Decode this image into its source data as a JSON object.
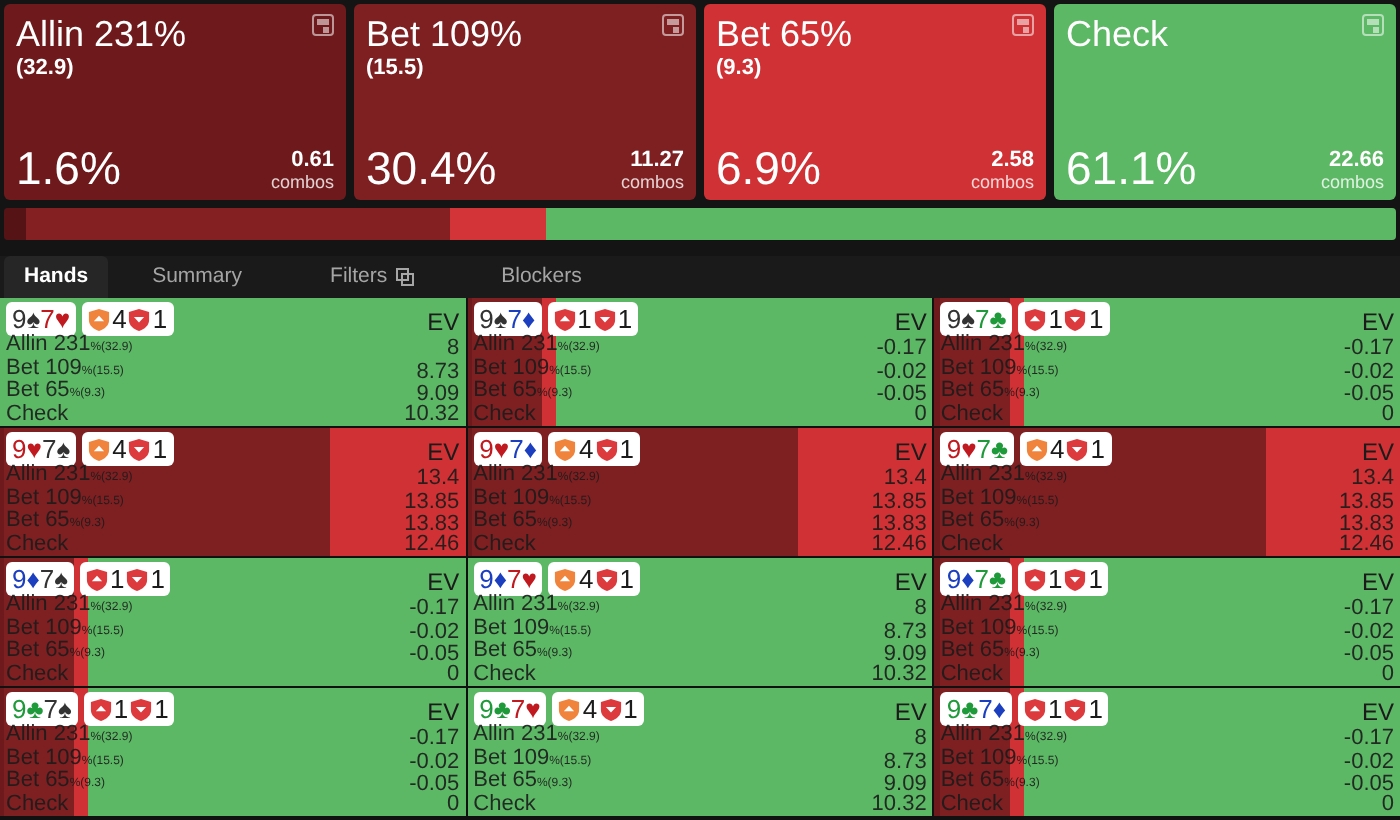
{
  "actions": [
    {
      "title": "Allin 231%",
      "sub": "(32.9)",
      "percent": "1.6%",
      "combos": "0.61",
      "combos_label": "combos",
      "color": "#6e1a1c",
      "bar": {
        "color": "#561315"
      }
    },
    {
      "title": "Bet 109%",
      "sub": "(15.5)",
      "percent": "30.4%",
      "combos": "11.27",
      "combos_label": "combos",
      "color": "#7e1f21",
      "bar": {
        "color": "#841f22"
      }
    },
    {
      "title": "Bet 65%",
      "sub": "(9.3)",
      "percent": "6.9%",
      "combos": "2.58",
      "combos_label": "combos",
      "color": "#cf3134",
      "bar": {
        "color": "#d23438"
      }
    },
    {
      "title": "Check",
      "percent": "61.1%",
      "combos": "22.66",
      "combos_label": "combos",
      "color": "#5cb865",
      "bar": {
        "color": "#5cb865"
      }
    }
  ],
  "tabs": [
    {
      "label": "Hands",
      "selected": true
    },
    {
      "label": "Summary",
      "selected": false
    },
    {
      "label": "Filters",
      "selected": false,
      "has_icon": true
    },
    {
      "label": "Blockers",
      "selected": false
    }
  ],
  "hands": [
    {
      "kind": "check",
      "cards": [
        {
          "rank": "9",
          "suit": "♠",
          "color": "#333333"
        },
        {
          "rank": "7",
          "suit": "♥",
          "color": "#c0191f"
        }
      ],
      "badges": [
        {
          "kind": "up",
          "color": "#f0843c",
          "count": "4"
        },
        {
          "kind": "down",
          "color": "#dd3a3d",
          "count": "1"
        }
      ],
      "ev_label": "EV",
      "lines": [
        {
          "name": "Allin 231",
          "sub": "%(32.9)",
          "ev": "8"
        },
        {
          "name": "Bet 109",
          "sub": "%(15.5)",
          "ev": "8.73"
        },
        {
          "name": "Bet 65",
          "sub": "%(9.3)",
          "ev": "9.09"
        },
        {
          "name": "Check",
          "ev": "10.32"
        }
      ]
    },
    {
      "kind": "check_heavy",
      "cards": [
        {
          "rank": "9",
          "suit": "♠",
          "color": "#333333"
        },
        {
          "rank": "7",
          "suit": "♦",
          "color": "#1c3fc0"
        }
      ],
      "badges": [
        {
          "kind": "up",
          "color": "#dd3a3d",
          "count": "1"
        },
        {
          "kind": "down",
          "color": "#dd3a3d",
          "count": "1"
        }
      ],
      "ev_label": "EV",
      "lines": [
        {
          "name": "Allin 231",
          "sub": "%(32.9)",
          "ev": "-0.17"
        },
        {
          "name": "Bet 109",
          "sub": "%(15.5)",
          "ev": "-0.02"
        },
        {
          "name": "Bet 65",
          "sub": "%(9.3)",
          "ev": "-0.05"
        },
        {
          "name": "Check",
          "ev": "0"
        }
      ]
    },
    {
      "kind": "check_heavy",
      "cards": [
        {
          "rank": "9",
          "suit": "♠",
          "color": "#333333"
        },
        {
          "rank": "7",
          "suit": "♣",
          "color": "#1f9a3a"
        }
      ],
      "badges": [
        {
          "kind": "up",
          "color": "#dd3a3d",
          "count": "1"
        },
        {
          "kind": "down",
          "color": "#dd3a3d",
          "count": "1"
        }
      ],
      "ev_label": "EV",
      "lines": [
        {
          "name": "Allin 231",
          "sub": "%(32.9)",
          "ev": "-0.17"
        },
        {
          "name": "Bet 109",
          "sub": "%(15.5)",
          "ev": "-0.02"
        },
        {
          "name": "Bet 65",
          "sub": "%(9.3)",
          "ev": "-0.05"
        },
        {
          "name": "Check",
          "ev": "0"
        }
      ]
    },
    {
      "kind": "bet_heavy",
      "cards": [
        {
          "rank": "9",
          "suit": "♥",
          "color": "#c0191f"
        },
        {
          "rank": "7",
          "suit": "♠",
          "color": "#333333"
        }
      ],
      "badges": [
        {
          "kind": "up",
          "color": "#f0843c",
          "count": "4"
        },
        {
          "kind": "down",
          "color": "#dd3a3d",
          "count": "1"
        }
      ],
      "ev_label": "EV",
      "lines": [
        {
          "name": "Allin 231",
          "sub": "%(32.9)",
          "ev": "13.4"
        },
        {
          "name": "Bet 109",
          "sub": "%(15.5)",
          "ev": "13.85"
        },
        {
          "name": "Bet 65",
          "sub": "%(9.3)",
          "ev": "13.83"
        },
        {
          "name": "Check",
          "ev": "12.46"
        }
      ]
    },
    {
      "kind": "bet_heavy",
      "cards": [
        {
          "rank": "9",
          "suit": "♥",
          "color": "#c0191f"
        },
        {
          "rank": "7",
          "suit": "♦",
          "color": "#1c3fc0"
        }
      ],
      "badges": [
        {
          "kind": "up",
          "color": "#f0843c",
          "count": "4"
        },
        {
          "kind": "down",
          "color": "#dd3a3d",
          "count": "1"
        }
      ],
      "ev_label": "EV",
      "lines": [
        {
          "name": "Allin 231",
          "sub": "%(32.9)",
          "ev": "13.4"
        },
        {
          "name": "Bet 109",
          "sub": "%(15.5)",
          "ev": "13.85"
        },
        {
          "name": "Bet 65",
          "sub": "%(9.3)",
          "ev": "13.83"
        },
        {
          "name": "Check",
          "ev": "12.46"
        }
      ]
    },
    {
      "kind": "bet_heavy",
      "cards": [
        {
          "rank": "9",
          "suit": "♥",
          "color": "#c0191f"
        },
        {
          "rank": "7",
          "suit": "♣",
          "color": "#1f9a3a"
        }
      ],
      "badges": [
        {
          "kind": "up",
          "color": "#f0843c",
          "count": "4"
        },
        {
          "kind": "down",
          "color": "#dd3a3d",
          "count": "1"
        }
      ],
      "ev_label": "EV",
      "lines": [
        {
          "name": "Allin 231",
          "sub": "%(32.9)",
          "ev": "13.4"
        },
        {
          "name": "Bet 109",
          "sub": "%(15.5)",
          "ev": "13.85"
        },
        {
          "name": "Bet 65",
          "sub": "%(9.3)",
          "ev": "13.83"
        },
        {
          "name": "Check",
          "ev": "12.46"
        }
      ]
    },
    {
      "kind": "check_heavy",
      "cards": [
        {
          "rank": "9",
          "suit": "♦",
          "color": "#1c3fc0"
        },
        {
          "rank": "7",
          "suit": "♠",
          "color": "#333333"
        }
      ],
      "badges": [
        {
          "kind": "up",
          "color": "#dd3a3d",
          "count": "1"
        },
        {
          "kind": "down",
          "color": "#dd3a3d",
          "count": "1"
        }
      ],
      "ev_label": "EV",
      "lines": [
        {
          "name": "Allin 231",
          "sub": "%(32.9)",
          "ev": "-0.17"
        },
        {
          "name": "Bet 109",
          "sub": "%(15.5)",
          "ev": "-0.02"
        },
        {
          "name": "Bet 65",
          "sub": "%(9.3)",
          "ev": "-0.05"
        },
        {
          "name": "Check",
          "ev": "0"
        }
      ]
    },
    {
      "kind": "check",
      "cards": [
        {
          "rank": "9",
          "suit": "♦",
          "color": "#1c3fc0"
        },
        {
          "rank": "7",
          "suit": "♥",
          "color": "#c0191f"
        }
      ],
      "badges": [
        {
          "kind": "up",
          "color": "#f0843c",
          "count": "4"
        },
        {
          "kind": "down",
          "color": "#dd3a3d",
          "count": "1"
        }
      ],
      "ev_label": "EV",
      "lines": [
        {
          "name": "Allin 231",
          "sub": "%(32.9)",
          "ev": "8"
        },
        {
          "name": "Bet 109",
          "sub": "%(15.5)",
          "ev": "8.73"
        },
        {
          "name": "Bet 65",
          "sub": "%(9.3)",
          "ev": "9.09"
        },
        {
          "name": "Check",
          "ev": "10.32"
        }
      ]
    },
    {
      "kind": "check_heavy",
      "cards": [
        {
          "rank": "9",
          "suit": "♦",
          "color": "#1c3fc0"
        },
        {
          "rank": "7",
          "suit": "♣",
          "color": "#1f9a3a"
        }
      ],
      "badges": [
        {
          "kind": "up",
          "color": "#dd3a3d",
          "count": "1"
        },
        {
          "kind": "down",
          "color": "#dd3a3d",
          "count": "1"
        }
      ],
      "ev_label": "EV",
      "lines": [
        {
          "name": "Allin 231",
          "sub": "%(32.9)",
          "ev": "-0.17"
        },
        {
          "name": "Bet 109",
          "sub": "%(15.5)",
          "ev": "-0.02"
        },
        {
          "name": "Bet 65",
          "sub": "%(9.3)",
          "ev": "-0.05"
        },
        {
          "name": "Check",
          "ev": "0"
        }
      ]
    },
    {
      "kind": "check_heavy",
      "cards": [
        {
          "rank": "9",
          "suit": "♣",
          "color": "#1f9a3a"
        },
        {
          "rank": "7",
          "suit": "♠",
          "color": "#333333"
        }
      ],
      "badges": [
        {
          "kind": "up",
          "color": "#dd3a3d",
          "count": "1"
        },
        {
          "kind": "down",
          "color": "#dd3a3d",
          "count": "1"
        }
      ],
      "ev_label": "EV",
      "lines": [
        {
          "name": "Allin 231",
          "sub": "%(32.9)",
          "ev": "-0.17"
        },
        {
          "name": "Bet 109",
          "sub": "%(15.5)",
          "ev": "-0.02"
        },
        {
          "name": "Bet 65",
          "sub": "%(9.3)",
          "ev": "-0.05"
        },
        {
          "name": "Check",
          "ev": "0"
        }
      ]
    },
    {
      "kind": "check",
      "cards": [
        {
          "rank": "9",
          "suit": "♣",
          "color": "#1f9a3a"
        },
        {
          "rank": "7",
          "suit": "♥",
          "color": "#c0191f"
        }
      ],
      "badges": [
        {
          "kind": "up",
          "color": "#f0843c",
          "count": "4"
        },
        {
          "kind": "down",
          "color": "#dd3a3d",
          "count": "1"
        }
      ],
      "ev_label": "EV",
      "lines": [
        {
          "name": "Allin 231",
          "sub": "%(32.9)",
          "ev": "8"
        },
        {
          "name": "Bet 109",
          "sub": "%(15.5)",
          "ev": "8.73"
        },
        {
          "name": "Bet 65",
          "sub": "%(9.3)",
          "ev": "9.09"
        },
        {
          "name": "Check",
          "ev": "10.32"
        }
      ]
    },
    {
      "kind": "check_heavy",
      "cards": [
        {
          "rank": "9",
          "suit": "♣",
          "color": "#1f9a3a"
        },
        {
          "rank": "7",
          "suit": "♦",
          "color": "#1c3fc0"
        }
      ],
      "badges": [
        {
          "kind": "up",
          "color": "#dd3a3d",
          "count": "1"
        },
        {
          "kind": "down",
          "color": "#dd3a3d",
          "count": "1"
        }
      ],
      "ev_label": "EV",
      "lines": [
        {
          "name": "Allin 231",
          "sub": "%(32.9)",
          "ev": "-0.17"
        },
        {
          "name": "Bet 109",
          "sub": "%(15.5)",
          "ev": "-0.02"
        },
        {
          "name": "Bet 65",
          "sub": "%(9.3)",
          "ev": "-0.05"
        },
        {
          "name": "Check",
          "ev": "0"
        }
      ]
    }
  ]
}
